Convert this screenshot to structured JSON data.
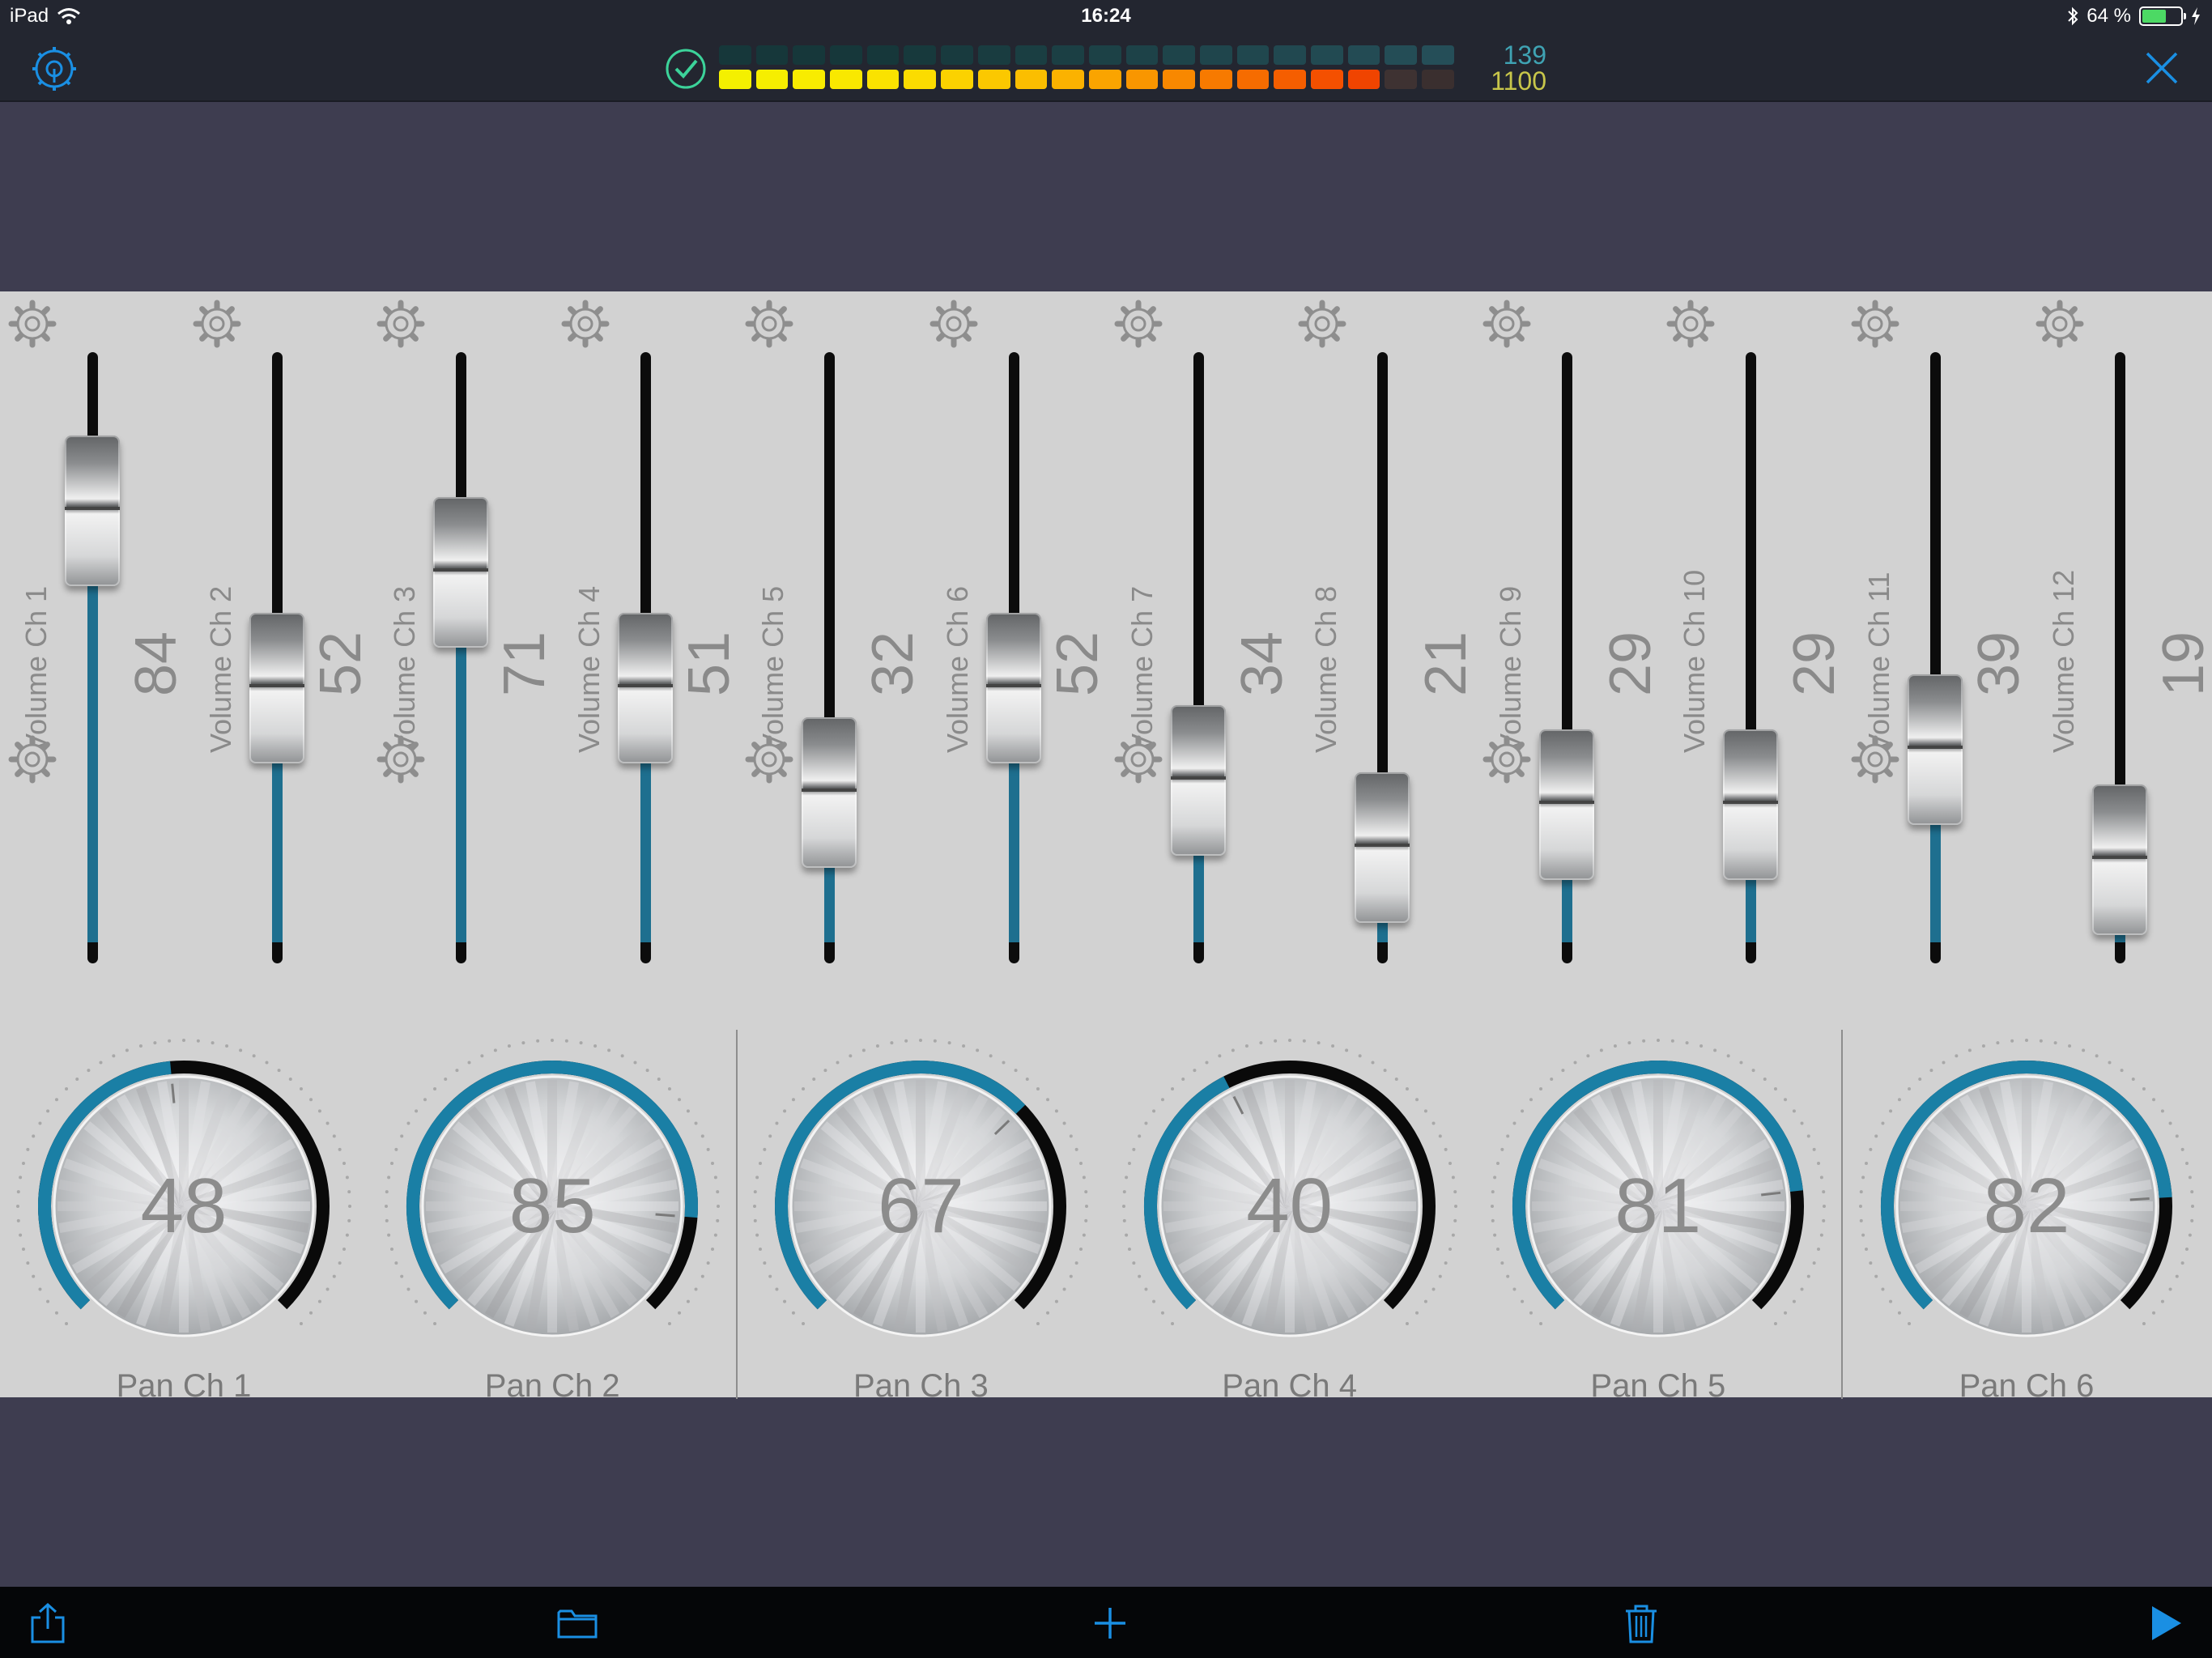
{
  "status_bar": {
    "device": "iPad",
    "time": "16:24",
    "battery_text": "64 %",
    "battery_level": 0.64
  },
  "header": {
    "meter_counts": [
      "139",
      "1100"
    ],
    "meter_top_colors": [
      "#16373a",
      "#16373a",
      "#16373a",
      "#16373a",
      "#16373a",
      "#17393c",
      "#183a3e",
      "#193c40",
      "#1a3e42",
      "#1b3f44",
      "#1c4146",
      "#1d4248",
      "#1e444a",
      "#1f454c",
      "#20474e",
      "#214850",
      "#224a52",
      "#234b54",
      "#244d56",
      "#254e58"
    ],
    "meter_bottom_colors": [
      "#f4f000",
      "#f6ee00",
      "#f8ec00",
      "#f9e800",
      "#fae200",
      "#fbdc00",
      "#fbd200",
      "#fbc800",
      "#fbbe00",
      "#fbb200",
      "#faa400",
      "#f99600",
      "#f88800",
      "#f77a00",
      "#f66c00",
      "#f55e00",
      "#f45000",
      "#f04400",
      "#3e3232",
      "#3a2f2f"
    ]
  },
  "volume_faders": [
    {
      "label": "Volume Ch 1",
      "value": "84",
      "level": 0.74
    },
    {
      "label": "Volume Ch 2",
      "value": "52",
      "level": 0.45
    },
    {
      "label": "Volume Ch 3",
      "value": "71",
      "level": 0.64
    },
    {
      "label": "Volume Ch 4",
      "value": "51",
      "level": 0.45
    },
    {
      "label": "Volume Ch 5",
      "value": "32",
      "level": 0.28
    },
    {
      "label": "Volume Ch 6",
      "value": "52",
      "level": 0.45
    },
    {
      "label": "Volume Ch 7",
      "value": "34",
      "level": 0.3
    },
    {
      "label": "Volume Ch 8",
      "value": "21",
      "level": 0.19
    },
    {
      "label": "Volume Ch 9",
      "value": "29",
      "level": 0.26
    },
    {
      "label": "Volume Ch 10",
      "value": "29",
      "level": 0.26
    },
    {
      "label": "Volume Ch 11",
      "value": "39",
      "level": 0.35
    },
    {
      "label": "Volume Ch 12",
      "value": "19",
      "level": 0.17
    }
  ],
  "pan_knobs": [
    {
      "label": "Pan Ch 1",
      "value": "48"
    },
    {
      "label": "Pan Ch 2",
      "value": "85"
    },
    {
      "label": "Pan Ch 3",
      "value": "67"
    },
    {
      "label": "Pan Ch 4",
      "value": "40"
    },
    {
      "label": "Pan Ch 5",
      "value": "81"
    },
    {
      "label": "Pan Ch 6",
      "value": "82"
    }
  ],
  "colors": {
    "accent": "#1a8fe3",
    "active_fader": "#1e6f8f",
    "active_knob": "#1a7fa5"
  },
  "icons": {
    "settings": "settings-icon",
    "check": "check-circle-icon",
    "close": "close-icon",
    "gear": "gear-icon",
    "share": "share-icon",
    "folder": "folder-icon",
    "add": "plus-icon",
    "trash": "trash-icon",
    "play": "play-icon"
  }
}
